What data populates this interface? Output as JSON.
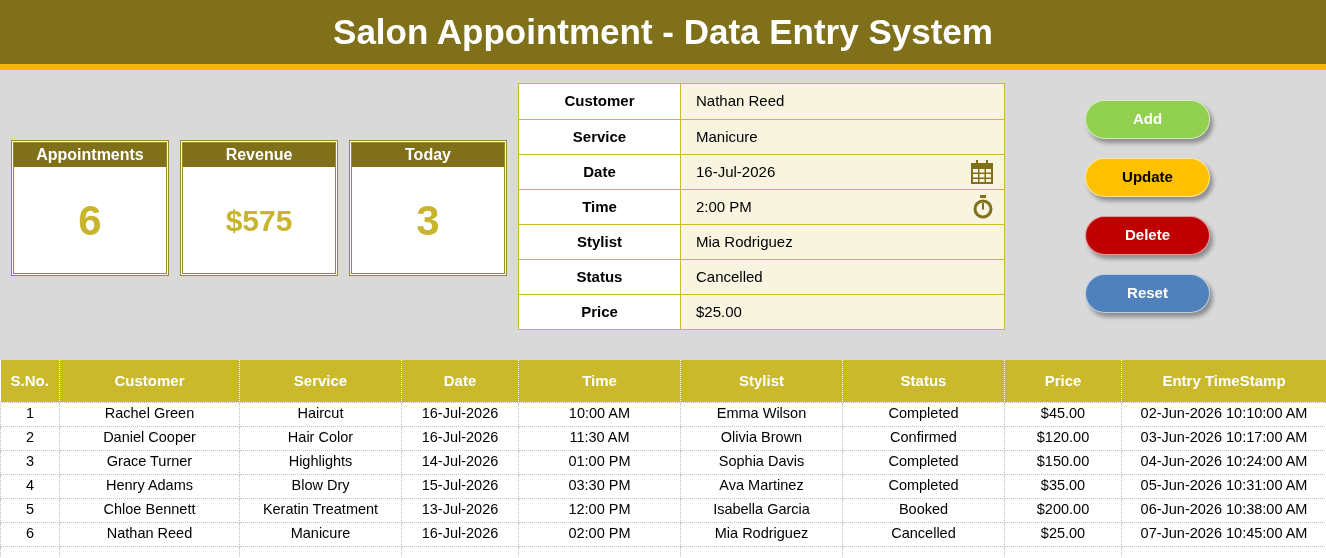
{
  "title": "Salon Appointment - Data Entry System",
  "cards": [
    {
      "label": "Appointments",
      "value": "6"
    },
    {
      "label": "Revenue",
      "value": "$575"
    },
    {
      "label": "Today",
      "value": "3"
    }
  ],
  "form": [
    {
      "label": "Customer",
      "value": "Nathan Reed",
      "kind": "text"
    },
    {
      "label": "Service",
      "value": "Manicure",
      "kind": "text"
    },
    {
      "label": "Date",
      "value": "16-Jul-2026",
      "kind": "date"
    },
    {
      "label": "Time",
      "value": "2:00 PM",
      "kind": "time"
    },
    {
      "label": "Stylist",
      "value": "Mia Rodriguez",
      "kind": "text"
    },
    {
      "label": "Status",
      "value": "Cancelled",
      "kind": "text"
    },
    {
      "label": "Price",
      "value": "$25.00",
      "kind": "text"
    }
  ],
  "buttons": [
    {
      "label": "Add",
      "color": "#92d050"
    },
    {
      "label": "Update",
      "color": "#ffc000"
    },
    {
      "label": "Delete",
      "color": "#c00000"
    },
    {
      "label": "Reset",
      "color": "#4f81bd"
    }
  ],
  "table": {
    "columns": [
      "S.No.",
      "Customer",
      "Service",
      "Date",
      "Time",
      "Stylist",
      "Status",
      "Price",
      "Entry TimeStamp"
    ],
    "rows": [
      [
        "1",
        "Rachel Green",
        "Haircut",
        "16-Jul-2026",
        "10:00 AM",
        "Emma Wilson",
        "Completed",
        "$45.00",
        "02-Jun-2026 10:10:00 AM"
      ],
      [
        "2",
        "Daniel Cooper",
        "Hair Color",
        "16-Jul-2026",
        "11:30 AM",
        "Olivia Brown",
        "Confirmed",
        "$120.00",
        "03-Jun-2026 10:17:00 AM"
      ],
      [
        "3",
        "Grace Turner",
        "Highlights",
        "14-Jul-2026",
        "01:00 PM",
        "Sophia Davis",
        "Completed",
        "$150.00",
        "04-Jun-2026 10:24:00 AM"
      ],
      [
        "4",
        "Henry Adams",
        "Blow Dry",
        "15-Jul-2026",
        "03:30 PM",
        "Ava Martinez",
        "Completed",
        "$35.00",
        "05-Jun-2026 10:31:00 AM"
      ],
      [
        "5",
        "Chloe Bennett",
        "Keratin Treatment",
        "13-Jul-2026",
        "12:00 PM",
        "Isabella Garcia",
        "Booked",
        "$200.00",
        "06-Jun-2026 10:38:00 AM"
      ],
      [
        "6",
        "Nathan Reed",
        "Manicure",
        "16-Jul-2026",
        "02:00 PM",
        "Mia Rodriguez",
        "Cancelled",
        "$25.00",
        "07-Jun-2026 10:45:00 AM"
      ]
    ]
  }
}
